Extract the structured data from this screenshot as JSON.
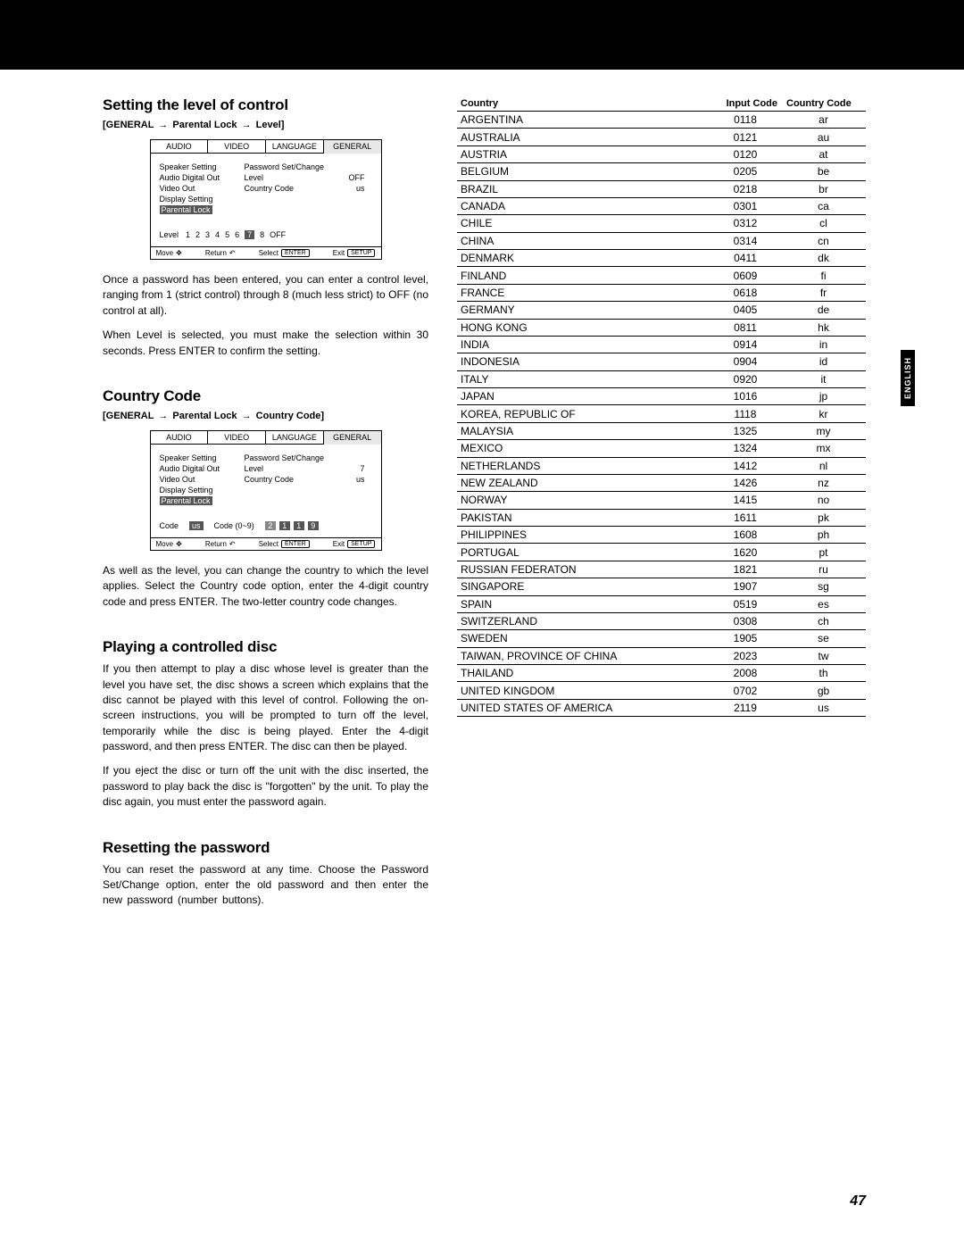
{
  "langTab": "ENGLISH",
  "pageNumber": "47",
  "section1": {
    "title": "Setting the level of control",
    "breadcrumb": [
      "GENERAL",
      "Parental Lock",
      "Level"
    ],
    "para1": "Once a password has been entered, you can enter a control level, ranging from 1 (strict control) through 8 (much less strict) to OFF (no control at all).",
    "para2": "When Level is selected, you must make the selection within 30 seconds. Press ENTER to confirm the setting."
  },
  "section2": {
    "title": "Country Code",
    "breadcrumb": [
      "GENERAL",
      "Parental Lock",
      "Country Code"
    ],
    "para1": "As well as the level, you can change the country to which the level applies. Select the Country code option, enter the 4-digit country code and press ENTER. The two-letter country code changes."
  },
  "section3": {
    "title": "Playing a controlled disc",
    "para1": "If you then attempt to play a disc whose level is greater than the level you have set, the disc shows a screen which explains that the disc cannot be played with this level of control. Following the on-screen instructions, you will be prompted to turn off the level, temporarily while the disc is being played. Enter the 4-digit password, and then press ENTER. The disc can then be played.",
    "para2": "If you eject the disc or turn off the unit with the disc inserted, the password to play back the disc is \"forgotten\" by the unit. To play the disc again, you must enter the password again."
  },
  "section4": {
    "title": "Resetting the password",
    "para1": "You can reset the password at any time. Choose the Password Set/Change option, enter the old password and then enter the new password (number buttons)."
  },
  "menu": {
    "tabs": [
      "AUDIO",
      "VIDEO",
      "LANGUAGE",
      "GENERAL"
    ],
    "side": [
      "Speaker Setting",
      "Audio Digital Out",
      "Video Out",
      "Display Setting",
      "Parental Lock"
    ],
    "sub_pw": "Password Set/Change",
    "sub_level": "Level",
    "sub_level_val_off": "OFF",
    "sub_level_val_7": "7",
    "sub_cc": "Country Code",
    "sub_cc_val": "us",
    "levelLabel": "Level",
    "levels": [
      "1",
      "2",
      "3",
      "4",
      "5",
      "6",
      "7",
      "8",
      "OFF"
    ],
    "levelSelected": "7",
    "codeLabel": "Code",
    "codeVal": "us",
    "codeRange": "Code (0~9)",
    "codeDigits": [
      "2",
      "1",
      "1",
      "9"
    ],
    "footer": {
      "move": "Move",
      "return": "Return",
      "select": "Select",
      "selectBtn": "ENTER",
      "exit": "Exit",
      "exitBtn": "SETUP"
    }
  },
  "tableHeaders": {
    "country": "Country",
    "input": "Input Code",
    "cc": "Country Code"
  },
  "countries": [
    {
      "n": "ARGENTINA",
      "i": "0118",
      "c": "ar"
    },
    {
      "n": "AUSTRALIA",
      "i": "0121",
      "c": "au"
    },
    {
      "n": "AUSTRIA",
      "i": "0120",
      "c": "at"
    },
    {
      "n": "BELGIUM",
      "i": "0205",
      "c": "be"
    },
    {
      "n": "BRAZIL",
      "i": "0218",
      "c": "br"
    },
    {
      "n": "CANADA",
      "i": "0301",
      "c": "ca"
    },
    {
      "n": "CHILE",
      "i": "0312",
      "c": "cl"
    },
    {
      "n": "CHINA",
      "i": "0314",
      "c": "cn"
    },
    {
      "n": "DENMARK",
      "i": "0411",
      "c": "dk"
    },
    {
      "n": "FINLAND",
      "i": "0609",
      "c": "fi"
    },
    {
      "n": "FRANCE",
      "i": "0618",
      "c": "fr"
    },
    {
      "n": "GERMANY",
      "i": "0405",
      "c": "de"
    },
    {
      "n": "HONG KONG",
      "i": "0811",
      "c": "hk"
    },
    {
      "n": "INDIA",
      "i": "0914",
      "c": "in"
    },
    {
      "n": "INDONESIA",
      "i": "0904",
      "c": "id"
    },
    {
      "n": "ITALY",
      "i": "0920",
      "c": "it"
    },
    {
      "n": "JAPAN",
      "i": "1016",
      "c": "jp"
    },
    {
      "n": "KOREA, REPUBLIC OF",
      "i": "1118",
      "c": "kr"
    },
    {
      "n": "MALAYSIA",
      "i": "1325",
      "c": "my"
    },
    {
      "n": "MEXICO",
      "i": "1324",
      "c": "mx"
    },
    {
      "n": "NETHERLANDS",
      "i": "1412",
      "c": "nl"
    },
    {
      "n": "NEW ZEALAND",
      "i": "1426",
      "c": "nz"
    },
    {
      "n": "NORWAY",
      "i": "1415",
      "c": "no"
    },
    {
      "n": "PAKISTAN",
      "i": "1611",
      "c": "pk"
    },
    {
      "n": "PHILIPPINES",
      "i": "1608",
      "c": "ph"
    },
    {
      "n": "PORTUGAL",
      "i": "1620",
      "c": "pt"
    },
    {
      "n": "RUSSIAN FEDERATON",
      "i": "1821",
      "c": "ru"
    },
    {
      "n": "SINGAPORE",
      "i": "1907",
      "c": "sg"
    },
    {
      "n": "SPAIN",
      "i": "0519",
      "c": "es"
    },
    {
      "n": "SWITZERLAND",
      "i": "0308",
      "c": "ch"
    },
    {
      "n": "SWEDEN",
      "i": "1905",
      "c": "se"
    },
    {
      "n": "TAIWAN, PROVINCE OF CHINA",
      "i": "2023",
      "c": "tw"
    },
    {
      "n": "THAILAND",
      "i": "2008",
      "c": "th"
    },
    {
      "n": "UNITED KINGDOM",
      "i": "0702",
      "c": "gb"
    },
    {
      "n": "UNITED STATES OF AMERICA",
      "i": "2119",
      "c": "us"
    }
  ]
}
